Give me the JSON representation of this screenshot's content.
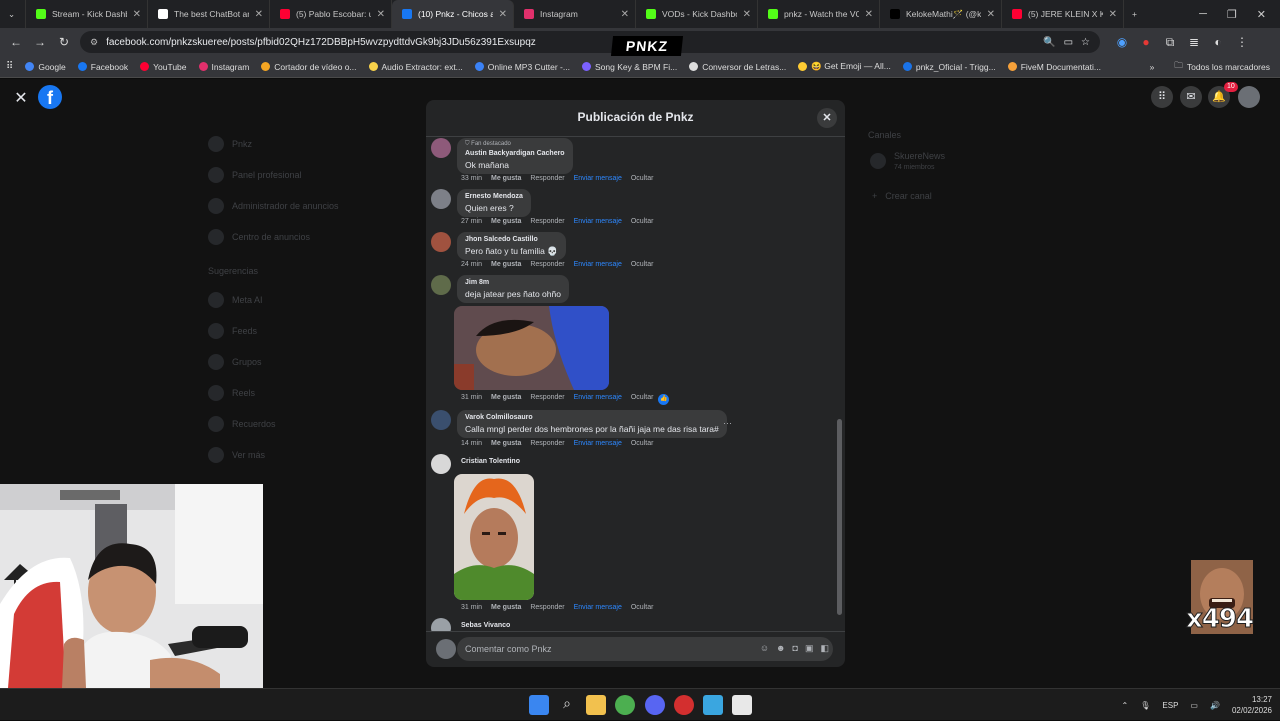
{
  "browser": {
    "tabs": [
      {
        "title": "Stream - Kick Dashbo",
        "color": "#53fc18"
      },
      {
        "title": "The best ChatBot and",
        "color": "#ffffff"
      },
      {
        "title": "(5) Pablo Escobar: un",
        "color": "#ff0033"
      },
      {
        "title": "(10) Pnkz - Chicos ac",
        "color": "#1877f2",
        "active": true
      },
      {
        "title": "Instagram",
        "color": "#e1306c"
      },
      {
        "title": "VODs - Kick Dashbo",
        "color": "#53fc18"
      },
      {
        "title": "pnkz - Watch the VO",
        "color": "#53fc18"
      },
      {
        "title": "KelokeMathi🪄 (@ke",
        "color": "#000000"
      },
      {
        "title": "(5) JERE KLEIN X KAT",
        "color": "#ff0033"
      }
    ],
    "url": "facebook.com/pnkzskueree/posts/pfbid02QHz172DBBpH5wvzpydttdvGk9bj3JDu56z391Exsupqz",
    "overlay_logo": "PNKZ",
    "bookmarks": [
      {
        "label": "Google",
        "color": "#4285f4"
      },
      {
        "label": "Facebook",
        "color": "#1877f2"
      },
      {
        "label": "YouTube",
        "color": "#ff0033"
      },
      {
        "label": "Instagram",
        "color": "#e1306c"
      },
      {
        "label": "Cortador de vídeo o...",
        "color": "#f5a623"
      },
      {
        "label": "Audio Extractor: ext...",
        "color": "#f8d24a"
      },
      {
        "label": "Online MP3 Cutter -...",
        "color": "#3b82f6"
      },
      {
        "label": "Song Key & BPM Fi...",
        "color": "#7b61ff"
      },
      {
        "label": "Conversor de Letras...",
        "color": "#dddddd"
      },
      {
        "label": "😆 Get Emoji — All...",
        "color": "#ffcc33"
      },
      {
        "label": "pnkz_Oficial - Trigg...",
        "color": "#1a73e8"
      },
      {
        "label": "FiveM Documentati...",
        "color": "#f6a13a"
      }
    ],
    "bookmarks_folder": "Todos los marcadores"
  },
  "fb": {
    "notification_count": "10",
    "sidebar_dim": [
      "Pnkz",
      "Panel profesional",
      "Administrador de anuncios",
      "Centro de anuncios",
      "Sugerencias",
      "Meta AI",
      "Feeds",
      "Grupos",
      "Reels",
      "Recuerdos",
      "Ver más"
    ],
    "channels_title": "Canales",
    "channel_name": "SkuereNews",
    "channel_members": "74 miembros",
    "create_channel": "Crear canal"
  },
  "modal": {
    "title": "Publicación de Pnkz",
    "actions": {
      "like": "Me gusta",
      "reply": "Responder",
      "send": "Enviar mensaje",
      "hide": "Ocultar"
    },
    "comments": [
      {
        "badge": "Fan destacado",
        "author": "Austin Backyardigan Cachero",
        "text": "Ok mañana",
        "time": "33 min"
      },
      {
        "author": "Ernesto Mendoza",
        "text": "Quien eres ?",
        "time": "27 min"
      },
      {
        "author": "Jhon Salcedo Castillo",
        "text": "Pero ñato y tu familia 💀",
        "time": "24 min"
      },
      {
        "author": "Jim 8m",
        "text": "deja jatear pes ñato ohño",
        "time": "31 min"
      },
      {
        "author": "Varok Colmillosauro",
        "text": "Calla mngl perder dos hembrones por la ñañi jaja me das risa tara#",
        "time": "14 min"
      },
      {
        "author": "Cristian Tolentino",
        "text": "",
        "time": "31 min"
      },
      {
        "author": "Sebas Vivanco",
        "text": "",
        "time": ""
      }
    ],
    "composer_placeholder": "Comentar como Pnkz"
  },
  "meme_label": "x494",
  "taskbar": {
    "lang": "ESP",
    "time": "13:27",
    "date": "02/02/2026"
  }
}
